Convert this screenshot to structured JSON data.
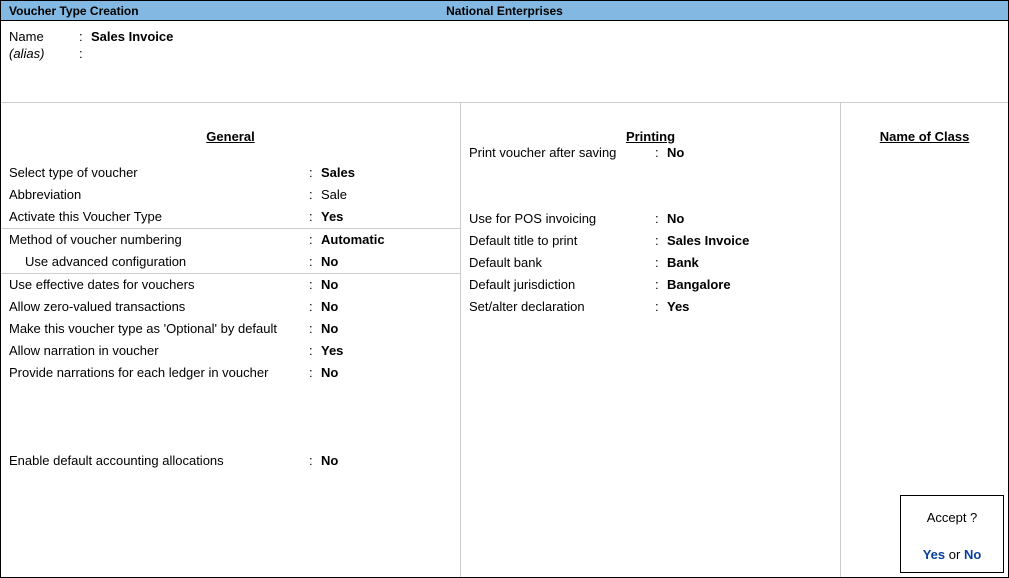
{
  "titlebar": {
    "left": "Voucher Type Creation",
    "center": "National Enterprises"
  },
  "header": {
    "name_label": "Name",
    "name_value": "Sales Invoice",
    "alias_label": "(alias)",
    "alias_value": ""
  },
  "general": {
    "heading": "General",
    "select_type_label": "Select type of voucher",
    "select_type_value": "Sales",
    "abbreviation_label": "Abbreviation",
    "abbreviation_value": "Sale",
    "activate_label": "Activate this Voucher Type",
    "activate_value": "Yes",
    "numbering_label": "Method of voucher numbering",
    "numbering_value": "Automatic",
    "advanced_config_label": "Use advanced configuration",
    "advanced_config_value": "No",
    "effective_dates_label": "Use effective dates for vouchers",
    "effective_dates_value": "No",
    "zero_valued_label": "Allow zero-valued transactions",
    "zero_valued_value": "No",
    "optional_label": "Make this voucher type as 'Optional' by default",
    "optional_value": "No",
    "narration_voucher_label": "Allow narration in voucher",
    "narration_voucher_value": "Yes",
    "narration_ledger_label": "Provide narrations for each ledger in voucher",
    "narration_ledger_value": "No",
    "default_alloc_label": "Enable default accounting allocations",
    "default_alloc_value": "No"
  },
  "printing": {
    "heading": "Printing",
    "print_after_saving_label": "Print voucher after saving",
    "print_after_saving_value": "No",
    "pos_invoicing_label": "Use for POS invoicing",
    "pos_invoicing_value": "No",
    "default_title_label": "Default title to print",
    "default_title_value": "Sales Invoice",
    "default_bank_label": "Default bank",
    "default_bank_value": "Bank",
    "default_jurisdiction_label": "Default jurisdiction",
    "default_jurisdiction_value": "Bangalore",
    "set_alter_declaration_label": "Set/alter declaration",
    "set_alter_declaration_value": "Yes"
  },
  "class": {
    "heading": "Name of Class"
  },
  "accept": {
    "question": "Accept ?",
    "yes": "Yes",
    "or": "or",
    "no": "No"
  }
}
